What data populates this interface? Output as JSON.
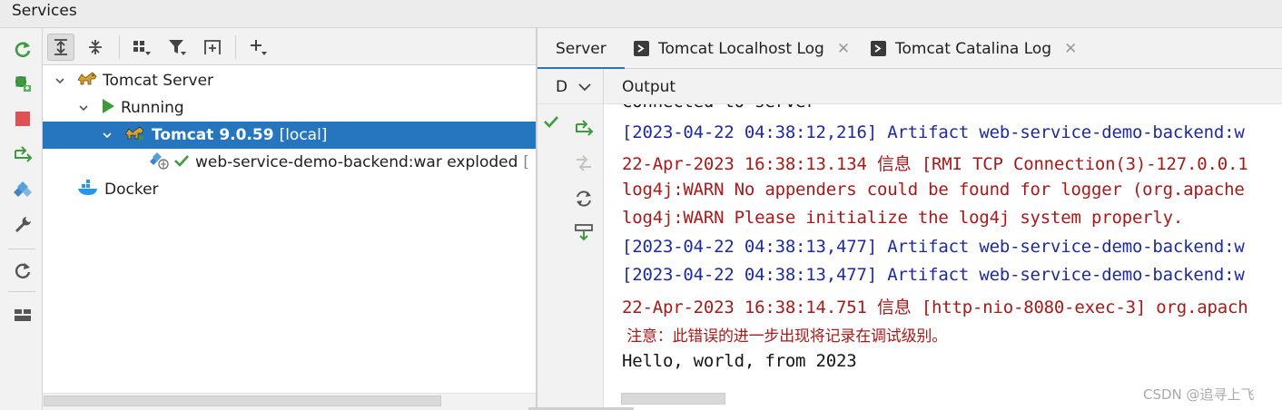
{
  "window": {
    "title": "Services"
  },
  "colors": {
    "selection": "#2675bf",
    "console_blue": "#1f2a9c",
    "console_red": "#a51a1a",
    "icon_green": "#3d9a3d",
    "stop_red": "#e05252"
  },
  "left_toolbar": {
    "icons": [
      "refresh-icon",
      "deploy-icon",
      "stop-icon",
      "redeploy-icon",
      "artifact-icon",
      "settings-icon",
      "reload-icon",
      "layout-icon"
    ]
  },
  "tree_toolbar": {
    "icons": [
      "expand-all-icon",
      "collapse-all-icon",
      "group-icon",
      "filter-icon",
      "new-service-icon",
      "add-icon"
    ]
  },
  "tree": {
    "items": [
      {
        "label": "Tomcat Server",
        "icon": "tomcat-icon",
        "expanded": true
      },
      {
        "label": "Running",
        "icon": "run-icon",
        "expanded": true
      },
      {
        "label": "Tomcat 9.0.59",
        "suffix": "[local]",
        "icon": "tomcat-icon",
        "selected": true
      },
      {
        "label": "web-service-demo-backend:war exploded",
        "suffix": "[",
        "icon": "artifact-icon"
      },
      {
        "label": "Docker",
        "icon": "docker-icon"
      }
    ]
  },
  "tabs": [
    {
      "label": "Server",
      "active": true
    },
    {
      "label": "Tomcat Localhost Log",
      "closable": true
    },
    {
      "label": "Tomcat Catalina Log",
      "closable": true
    }
  ],
  "subheader": {
    "deploy_label": "D",
    "output_label": "Output"
  },
  "console": {
    "lines": [
      {
        "text": "Connected to server",
        "color": "black"
      },
      {
        "text": "[2023-04-22 04:38:12,216] Artifact web-service-demo-backend:w",
        "color": "blue"
      },
      {
        "text": "22-Apr-2023 16:38:13.134 信息 [RMI TCP Connection(3)-127.0.0.1",
        "color": "red"
      },
      {
        "text": "log4j:WARN No appenders could be found for logger (org.apache",
        "color": "red"
      },
      {
        "text": "log4j:WARN Please initialize the log4j system properly.",
        "color": "red"
      },
      {
        "text": "[2023-04-22 04:38:13,477] Artifact web-service-demo-backend:w",
        "color": "blue"
      },
      {
        "text": "[2023-04-22 04:38:13,477] Artifact web-service-demo-backend:w",
        "color": "blue"
      },
      {
        "text": "22-Apr-2023 16:38:14.751 信息 [http-nio-8080-exec-3] org.apach",
        "color": "red"
      },
      {
        "text": " 注意：此错误的进一步出现将记录在调试级别。",
        "color": "red"
      },
      {
        "text": "Hello, world, from 2023",
        "color": "black"
      }
    ]
  },
  "watermark": "CSDN @追寻上飞"
}
